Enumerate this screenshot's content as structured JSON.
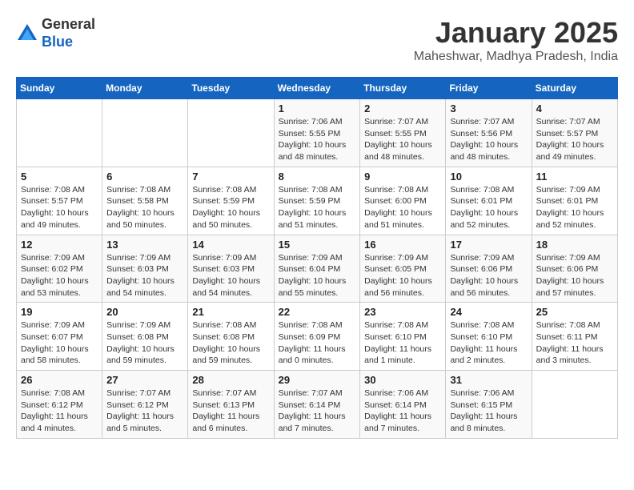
{
  "header": {
    "logo_general": "General",
    "logo_blue": "Blue",
    "title": "January 2025",
    "subtitle": "Maheshwar, Madhya Pradesh, India"
  },
  "weekdays": [
    "Sunday",
    "Monday",
    "Tuesday",
    "Wednesday",
    "Thursday",
    "Friday",
    "Saturday"
  ],
  "weeks": [
    [
      {
        "day": "",
        "info": ""
      },
      {
        "day": "",
        "info": ""
      },
      {
        "day": "",
        "info": ""
      },
      {
        "day": "1",
        "info": "Sunrise: 7:06 AM\nSunset: 5:55 PM\nDaylight: 10 hours\nand 48 minutes."
      },
      {
        "day": "2",
        "info": "Sunrise: 7:07 AM\nSunset: 5:55 PM\nDaylight: 10 hours\nand 48 minutes."
      },
      {
        "day": "3",
        "info": "Sunrise: 7:07 AM\nSunset: 5:56 PM\nDaylight: 10 hours\nand 48 minutes."
      },
      {
        "day": "4",
        "info": "Sunrise: 7:07 AM\nSunset: 5:57 PM\nDaylight: 10 hours\nand 49 minutes."
      }
    ],
    [
      {
        "day": "5",
        "info": "Sunrise: 7:08 AM\nSunset: 5:57 PM\nDaylight: 10 hours\nand 49 minutes."
      },
      {
        "day": "6",
        "info": "Sunrise: 7:08 AM\nSunset: 5:58 PM\nDaylight: 10 hours\nand 50 minutes."
      },
      {
        "day": "7",
        "info": "Sunrise: 7:08 AM\nSunset: 5:59 PM\nDaylight: 10 hours\nand 50 minutes."
      },
      {
        "day": "8",
        "info": "Sunrise: 7:08 AM\nSunset: 5:59 PM\nDaylight: 10 hours\nand 51 minutes."
      },
      {
        "day": "9",
        "info": "Sunrise: 7:08 AM\nSunset: 6:00 PM\nDaylight: 10 hours\nand 51 minutes."
      },
      {
        "day": "10",
        "info": "Sunrise: 7:08 AM\nSunset: 6:01 PM\nDaylight: 10 hours\nand 52 minutes."
      },
      {
        "day": "11",
        "info": "Sunrise: 7:09 AM\nSunset: 6:01 PM\nDaylight: 10 hours\nand 52 minutes."
      }
    ],
    [
      {
        "day": "12",
        "info": "Sunrise: 7:09 AM\nSunset: 6:02 PM\nDaylight: 10 hours\nand 53 minutes."
      },
      {
        "day": "13",
        "info": "Sunrise: 7:09 AM\nSunset: 6:03 PM\nDaylight: 10 hours\nand 54 minutes."
      },
      {
        "day": "14",
        "info": "Sunrise: 7:09 AM\nSunset: 6:03 PM\nDaylight: 10 hours\nand 54 minutes."
      },
      {
        "day": "15",
        "info": "Sunrise: 7:09 AM\nSunset: 6:04 PM\nDaylight: 10 hours\nand 55 minutes."
      },
      {
        "day": "16",
        "info": "Sunrise: 7:09 AM\nSunset: 6:05 PM\nDaylight: 10 hours\nand 56 minutes."
      },
      {
        "day": "17",
        "info": "Sunrise: 7:09 AM\nSunset: 6:06 PM\nDaylight: 10 hours\nand 56 minutes."
      },
      {
        "day": "18",
        "info": "Sunrise: 7:09 AM\nSunset: 6:06 PM\nDaylight: 10 hours\nand 57 minutes."
      }
    ],
    [
      {
        "day": "19",
        "info": "Sunrise: 7:09 AM\nSunset: 6:07 PM\nDaylight: 10 hours\nand 58 minutes."
      },
      {
        "day": "20",
        "info": "Sunrise: 7:09 AM\nSunset: 6:08 PM\nDaylight: 10 hours\nand 59 minutes."
      },
      {
        "day": "21",
        "info": "Sunrise: 7:08 AM\nSunset: 6:08 PM\nDaylight: 10 hours\nand 59 minutes."
      },
      {
        "day": "22",
        "info": "Sunrise: 7:08 AM\nSunset: 6:09 PM\nDaylight: 11 hours\nand 0 minutes."
      },
      {
        "day": "23",
        "info": "Sunrise: 7:08 AM\nSunset: 6:10 PM\nDaylight: 11 hours\nand 1 minute."
      },
      {
        "day": "24",
        "info": "Sunrise: 7:08 AM\nSunset: 6:10 PM\nDaylight: 11 hours\nand 2 minutes."
      },
      {
        "day": "25",
        "info": "Sunrise: 7:08 AM\nSunset: 6:11 PM\nDaylight: 11 hours\nand 3 minutes."
      }
    ],
    [
      {
        "day": "26",
        "info": "Sunrise: 7:08 AM\nSunset: 6:12 PM\nDaylight: 11 hours\nand 4 minutes."
      },
      {
        "day": "27",
        "info": "Sunrise: 7:07 AM\nSunset: 6:12 PM\nDaylight: 11 hours\nand 5 minutes."
      },
      {
        "day": "28",
        "info": "Sunrise: 7:07 AM\nSunset: 6:13 PM\nDaylight: 11 hours\nand 6 minutes."
      },
      {
        "day": "29",
        "info": "Sunrise: 7:07 AM\nSunset: 6:14 PM\nDaylight: 11 hours\nand 7 minutes."
      },
      {
        "day": "30",
        "info": "Sunrise: 7:06 AM\nSunset: 6:14 PM\nDaylight: 11 hours\nand 7 minutes."
      },
      {
        "day": "31",
        "info": "Sunrise: 7:06 AM\nSunset: 6:15 PM\nDaylight: 11 hours\nand 8 minutes."
      },
      {
        "day": "",
        "info": ""
      }
    ]
  ]
}
